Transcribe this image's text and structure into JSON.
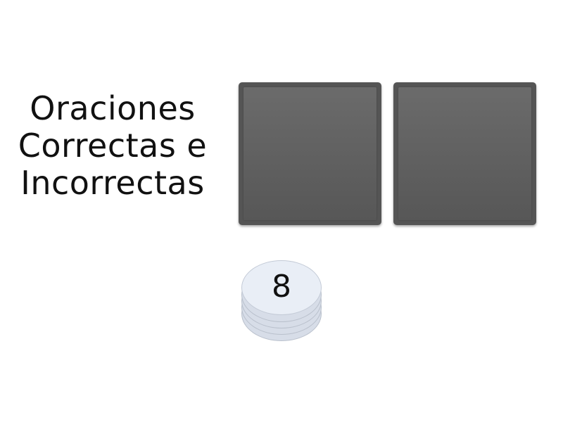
{
  "title": {
    "line1": "Oraciones",
    "line2": "Correctas e",
    "line3": "Incorrectas"
  },
  "cards": [
    {
      "state": "face-down"
    },
    {
      "state": "face-down"
    }
  ],
  "deck": {
    "remaining": "8"
  },
  "colors": {
    "card": "#5c5c5c",
    "deck": "#e9eef6",
    "text": "#111111"
  }
}
